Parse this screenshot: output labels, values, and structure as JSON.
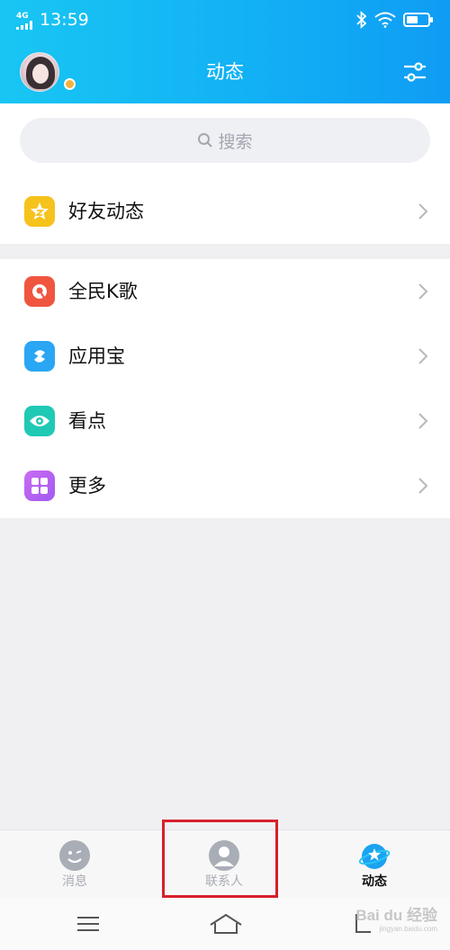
{
  "status_bar": {
    "network": "4G",
    "time": "13:59",
    "icons": [
      "signal-icon",
      "bluetooth-icon",
      "wifi-icon",
      "battery-icon"
    ]
  },
  "header": {
    "title": "动态",
    "avatar": "user-avatar",
    "filter_icon": "sliders-icon"
  },
  "search": {
    "placeholder": "搜索"
  },
  "sections": [
    {
      "label": "好友动态",
      "icon": "friends-feed-icon",
      "color": "#f6c21c"
    },
    {
      "label": "全民K歌",
      "icon": "karaoke-icon",
      "color": "#f0553f"
    },
    {
      "label": "应用宝",
      "icon": "app-store-icon",
      "color": "#2aa6f4"
    },
    {
      "label": "看点",
      "icon": "eye-icon",
      "color": "#1fc9b4"
    },
    {
      "label": "更多",
      "icon": "more-grid-icon",
      "color": "#c064f0"
    }
  ],
  "tabs": [
    {
      "label": "消息",
      "icon": "messages-icon",
      "active": false
    },
    {
      "label": "联系人",
      "icon": "contacts-icon",
      "active": false
    },
    {
      "label": "动态",
      "icon": "planet-star-icon",
      "active": true
    }
  ],
  "watermark": {
    "text": "Bai du 经验",
    "sub": "jingyan.baidu.com"
  },
  "colors": {
    "header_start": "#19c6f3",
    "header_end": "#0f9cf4",
    "highlight": "#d7202a"
  }
}
